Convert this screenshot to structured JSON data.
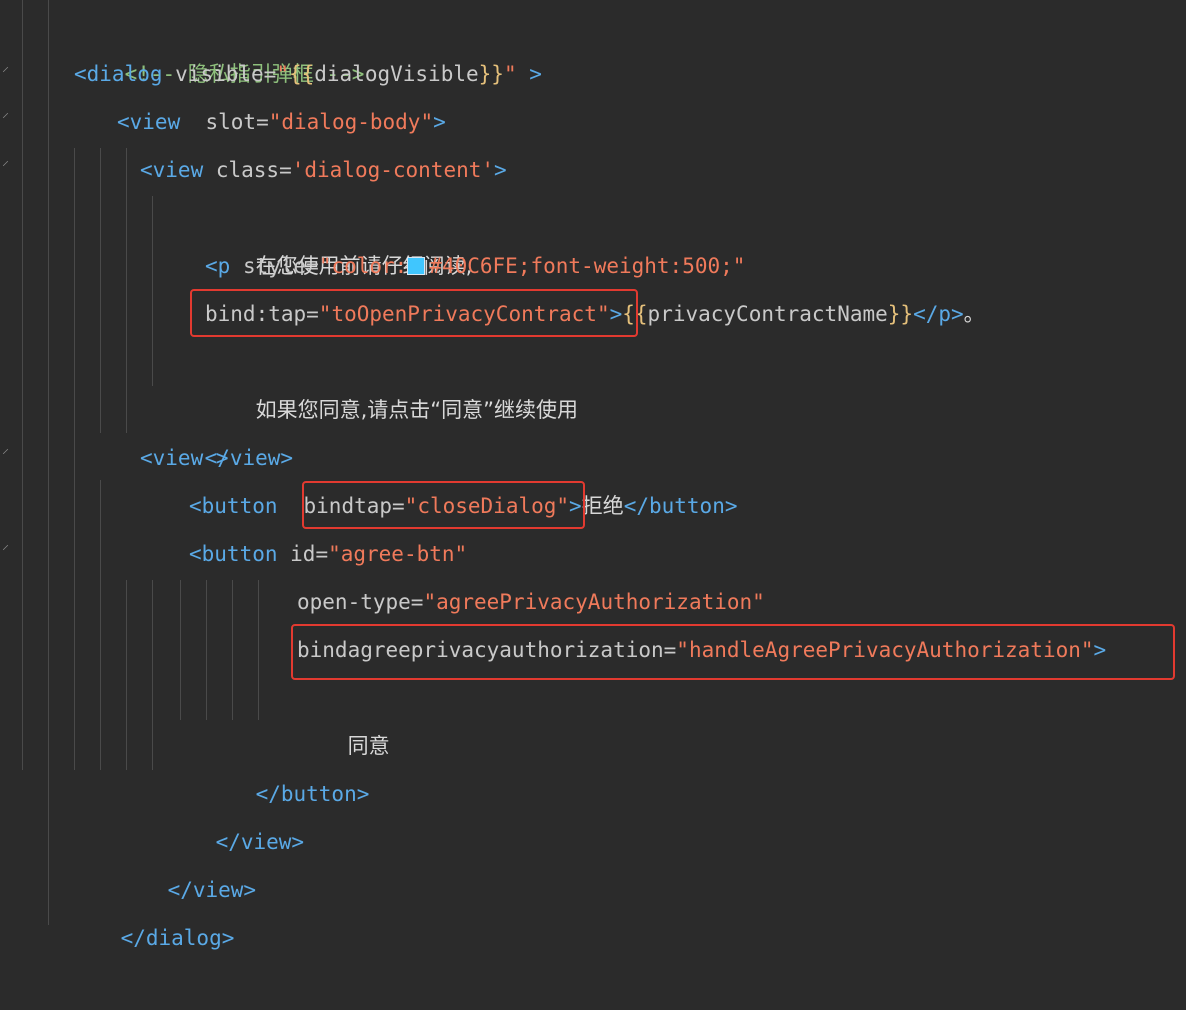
{
  "code": {
    "l1_comment": "<!-- 隐私指引弹框 -->",
    "l2": {
      "open": "<dialog",
      "attr": " visible=",
      "q1": "\"",
      "b1": "{{",
      "expr": "dialogVisible",
      "b2": "}}",
      "q2": "\"",
      "end": " >"
    },
    "l3": {
      "open": "<view",
      "attr": "  slot=",
      "val": "\"dialog-body\"",
      "end": ">"
    },
    "l4": {
      "open": "<view",
      "attr": " class=",
      "val": "'dialog-content'",
      "end": ">"
    },
    "l5_text": "在您使用前请仔细阅读,",
    "l6": {
      "open": "<p",
      "attr": " style=",
      "val_a": "\"color:",
      "val_b": "#40C6FE;font-weight:500;\"",
      "swatch_color": "#40C6FE"
    },
    "l7": {
      "attr": "bind:tap=",
      "val": "\"toOpenPrivacyContract\"",
      "close": ">",
      "b1": "{{",
      "expr": "privacyContractName",
      "b2": "}}",
      "endtag": "</p>",
      "tail": "。"
    },
    "l8_text": "如果您同意,请点击“同意”继续使用",
    "l9": "</view>",
    "l10": {
      "open": "<view",
      "end": " >"
    },
    "l11": {
      "open": "<button",
      "attr": "bindtap=",
      "val": "\"closeDialog\"",
      "close": ">",
      "text": "拒绝",
      "endtag": "</button>"
    },
    "l12": {
      "open": "<button",
      "attr": " id=",
      "val": "\"agree-btn\""
    },
    "l13": {
      "attr": "open-type=",
      "val": "\"agreePrivacyAuthorization\""
    },
    "l14": {
      "attr": "bindagreeprivacyauthorization=",
      "val": "\"handleAgreePrivacyAuthorization\"",
      "close": ">"
    },
    "l15_text": "同意",
    "l16": "</button>",
    "l17": "</view>",
    "l18": "</view>",
    "l19": "</dialog>"
  },
  "colors": {
    "background": "#2b2b2b",
    "tag": "#5aa9e6",
    "string": "#f07a5b",
    "comment": "#8ec07c",
    "highlight_box": "#e23a30"
  }
}
